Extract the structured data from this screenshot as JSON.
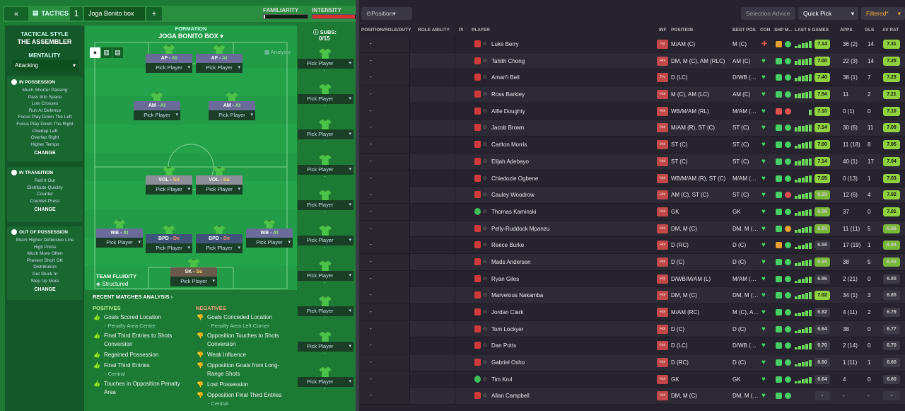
{
  "topbar": {
    "collapse": "«",
    "tactics": "TACTICS",
    "slot": "1",
    "tactic_name": "Joga Bonito box",
    "add": "+",
    "familiarity": "FAMILIARITY",
    "intensity": "INTENSITY",
    "familiarity_value": 0.04,
    "intensity_value": 0.97
  },
  "sidebar": {
    "tactical_style_label": "TACTICAL STYLE",
    "tactical_style": "THE ASSEMBLER",
    "mentality_label": "MENTALITY",
    "mentality": "Attacking",
    "in_possession": {
      "title": "IN POSSESSION",
      "items": [
        "Much Shorter Passing",
        "Pass Into Space",
        "Low Crosses",
        "Run At Defence",
        "Focus Play Down The Left",
        "Focus Play Down The Right",
        "Overlap Left",
        "Overlap Right",
        "Higher Tempo"
      ],
      "change": "CHANGE"
    },
    "in_transition": {
      "title": "IN TRANSITION",
      "items": [
        "Roll It Out",
        "Distribute Quickly",
        "Counter",
        "Counter-Press"
      ],
      "change": "CHANGE"
    },
    "out_of_possession": {
      "title": "OUT OF POSSESSION",
      "items": [
        "Much Higher Defensive Line",
        "High Press",
        "Much More Often",
        "Prevent Short GK",
        "Distribution",
        "Get Stuck In",
        "Step Up More"
      ],
      "change": "CHANGE"
    }
  },
  "formation": {
    "label": "FORMATION",
    "name": "JOGA BONITO BOX",
    "analysis": "Analysis",
    "subs_label": "SUBS:",
    "subs_count": "0/15",
    "fluidity_label": "TEAM FLUIDITY",
    "fluidity": "Structured",
    "pick": "Pick Player",
    "players": [
      {
        "role": "AF",
        "duty": "At"
      },
      {
        "role": "AF",
        "duty": "At"
      },
      {
        "role": "AM",
        "duty": "At"
      },
      {
        "role": "AM",
        "duty": "At"
      },
      {
        "role": "VOL",
        "duty": "Su"
      },
      {
        "role": "VOL",
        "duty": "Su"
      },
      {
        "role": "WB",
        "duty": "At"
      },
      {
        "role": "BPD",
        "duty": "De"
      },
      {
        "role": "BPD",
        "duty": "De"
      },
      {
        "role": "WB",
        "duty": "At"
      },
      {
        "role": "SK",
        "duty": "Su"
      }
    ]
  },
  "analysis": {
    "title": "RECENT MATCHES ANALYSIS ›",
    "positives_label": "POSITIVES",
    "negatives_label": "NEGATIVES",
    "positives": [
      {
        "t": "Goals Scored Location",
        "s": "- Penalty Area Centre"
      },
      {
        "t": "Final Third Entries to Shots Conversion",
        "s": ""
      },
      {
        "t": "Regained Possession",
        "s": ""
      },
      {
        "t": "Final Third Entries",
        "s": "- Central"
      },
      {
        "t": "Touches in Opposition Penalty Area",
        "s": ""
      }
    ],
    "negatives": [
      {
        "t": "Goals Conceded Location",
        "s": "- Penalty Area Left Corner"
      },
      {
        "t": "Opposition Touches to Shots Conversion",
        "s": ""
      },
      {
        "t": "Weak Influence",
        "s": ""
      },
      {
        "t": "Opposition Goals from Long-Range Shots",
        "s": ""
      },
      {
        "t": "Lost Possession",
        "s": ""
      },
      {
        "t": "Opposition Final Third Entries",
        "s": "- Central"
      }
    ]
  },
  "right": {
    "position_btn": "Position",
    "selection_advice": "Selection Advice",
    "quick_pick": "Quick Pick",
    "filtered": "Filtered*",
    "headers": {
      "pos_role": "POSITION/ROLE/DUTY",
      "role_ability": "ROLE ABILITY",
      "pi": "PI",
      "player": "PLAYER",
      "inf": "INF",
      "position": "POSITION",
      "best_pos": "BEST POS",
      "con": "CON",
      "shp": "SHP",
      "m": "M...",
      "last5": "LAST 5 GAMES",
      "apps": "APPS",
      "gls": "GLS",
      "av_rat": "AV RAT"
    },
    "players": [
      {
        "name": "Luke Berry",
        "inf": "Inj",
        "pos": "M/AM (C)",
        "best": "M (C)",
        "rat": "7.14",
        "apps": "36 (2)",
        "gls": "14",
        "av": "7.31"
      },
      {
        "name": "Tahith Chong",
        "inf": "Hol",
        "pos": "DM, M (C), AM (RLC)",
        "best": "AM (C)",
        "rat": "7.00",
        "apps": "22 (3)",
        "gls": "14",
        "av": "7.25"
      },
      {
        "name": "Amari'i Bell",
        "inf": "Trv",
        "pos": "D (LC)",
        "best": "D/WB (…",
        "rat": "7.40",
        "apps": "38 (1)",
        "gls": "7",
        "av": "7.23"
      },
      {
        "name": "Ross Barkley",
        "inf": "Hol",
        "pos": "M (C), AM (LC)",
        "best": "AM (C)",
        "rat": "7.54",
        "apps": "11",
        "gls": "2",
        "av": "7.21"
      },
      {
        "name": "Alfie Doughty",
        "inf": "Hol",
        "pos": "WB/M/AM (RL)",
        "best": "M/AM (…",
        "rat": "7.10",
        "apps": "0 (1)",
        "gls": "0",
        "av": "7.10"
      },
      {
        "name": "Jacob Brown",
        "inf": "Hol",
        "pos": "M/AM (R), ST (C)",
        "best": "ST (C)",
        "rat": "7.14",
        "apps": "30 (6)",
        "gls": "11",
        "av": "7.09"
      },
      {
        "name": "Carlton Morris",
        "inf": "Hol",
        "pos": "ST (C)",
        "best": "ST (C)",
        "rat": "7.00",
        "apps": "11 (18)",
        "gls": "8",
        "av": "7.05"
      },
      {
        "name": "Elijah Adebayo",
        "inf": "Hol",
        "pos": "ST (C)",
        "best": "ST (C)",
        "rat": "7.14",
        "apps": "40 (1)",
        "gls": "17",
        "av": "7.04"
      },
      {
        "name": "Chiedozie Ogbene",
        "inf": "Hol",
        "pos": "WB/M/AM (R), ST (C)",
        "best": "M/AM (…",
        "rat": "7.05",
        "apps": "0 (13)",
        "gls": "1",
        "av": "7.03"
      },
      {
        "name": "Cauley Woodrow",
        "inf": "Hol",
        "pos": "AM (C), ST (C)",
        "best": "ST (C)",
        "rat": "6.90",
        "apps": "12 (6)",
        "gls": "4",
        "av": "7.02"
      },
      {
        "name": "Thomas Kaminski",
        "inf": "Hol",
        "pos": "GK",
        "best": "GK",
        "rat": "6.96",
        "apps": "37",
        "gls": "0",
        "av": "7.01"
      },
      {
        "name": "Pelly-Ruddock Mpanzu",
        "inf": "Hol",
        "pos": "DM, M (C)",
        "best": "DM, M (…",
        "rat": "6.90",
        "apps": "11 (11)",
        "gls": "5",
        "av": "6.96"
      },
      {
        "name": "Reece Burke",
        "inf": "Hol",
        "pos": "D (RC)",
        "best": "D (C)",
        "rat": "6.58",
        "apps": "17 (19)",
        "gls": "1",
        "av": "6.94"
      },
      {
        "name": "Mads Andersen",
        "inf": "Hol",
        "pos": "D (C)",
        "best": "D (C)",
        "rat": "6.94",
        "apps": "38",
        "gls": "5",
        "av": "6.93"
      },
      {
        "name": "Ryan Giles",
        "inf": "Hol",
        "pos": "D/WB/M/AM (L)",
        "best": "M/AM (…",
        "rat": "6.86",
        "apps": "2 (21)",
        "gls": "0",
        "av": "6.85"
      },
      {
        "name": "Marvelous Nakamba",
        "inf": "Hol",
        "pos": "DM, M (C)",
        "best": "DM, M (…",
        "rat": "7.02",
        "apps": "34 (1)",
        "gls": "3",
        "av": "6.85"
      },
      {
        "name": "Jordan Clark",
        "inf": "Hol",
        "pos": "M/AM (RC)",
        "best": "M (C), A…",
        "rat": "6.82",
        "apps": "4 (11)",
        "gls": "2",
        "av": "6.79"
      },
      {
        "name": "Tom Lockyer",
        "inf": "Hol",
        "pos": "D (C)",
        "best": "D (C)",
        "rat": "6.64",
        "apps": "38",
        "gls": "0",
        "av": "6.77"
      },
      {
        "name": "Dan Potts",
        "inf": "Hol",
        "pos": "D (LC)",
        "best": "D/WB (…",
        "rat": "6.70",
        "apps": "2 (14)",
        "gls": "0",
        "av": "6.70"
      },
      {
        "name": "Gabriel Osho",
        "inf": "Hol",
        "pos": "D (RC)",
        "best": "D (C)",
        "rat": "6.60",
        "apps": "1 (11)",
        "gls": "1",
        "av": "6.60"
      },
      {
        "name": "Tim Krul",
        "inf": "Hol",
        "pos": "GK",
        "best": "GK",
        "rat": "6.64",
        "apps": "4",
        "gls": "0",
        "av": "6.60"
      },
      {
        "name": "Allan Campbell",
        "inf": "Hol",
        "pos": "DM, M (C)",
        "best": "DM, M (…",
        "rat": "-",
        "apps": "-",
        "gls": "-",
        "av": "-"
      }
    ]
  }
}
